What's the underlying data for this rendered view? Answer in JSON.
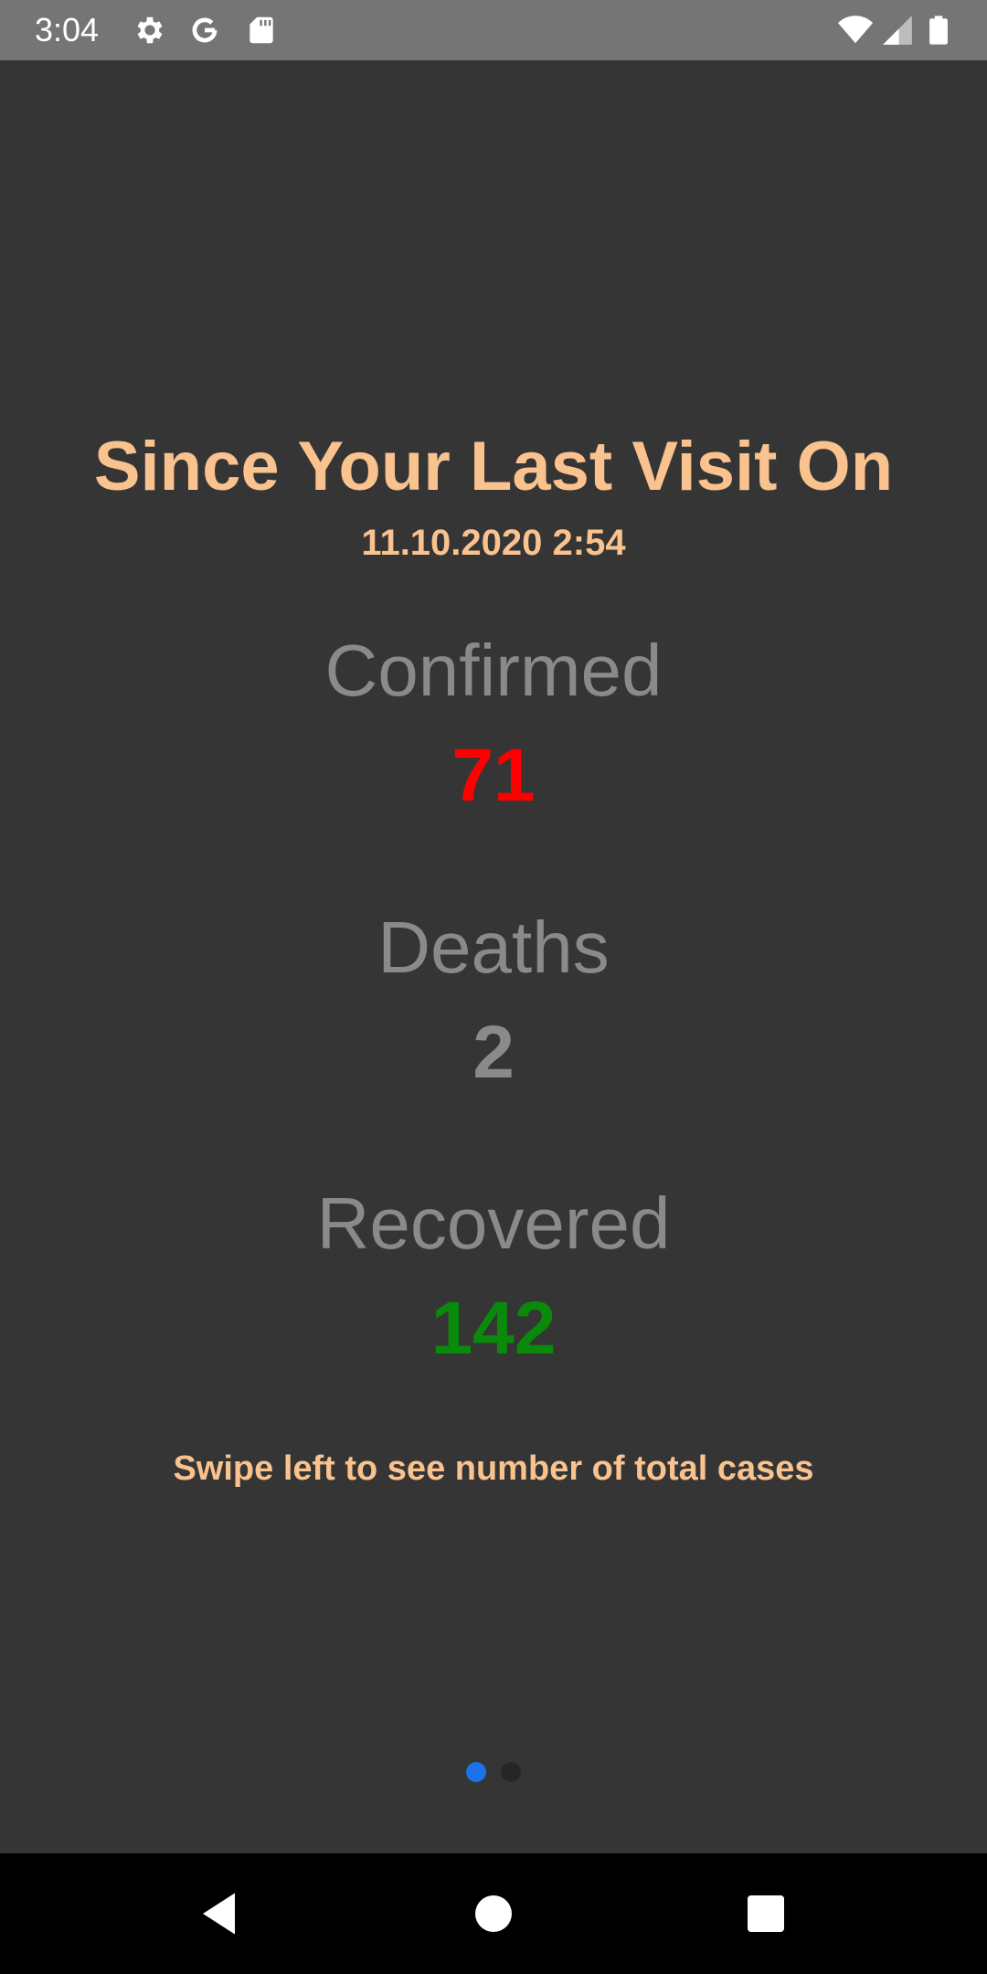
{
  "status_bar": {
    "time": "3:04",
    "icons": [
      "gear-icon",
      "google-icon",
      "sd-card-icon",
      "wifi-icon",
      "signal-icon",
      "battery-icon"
    ]
  },
  "page": {
    "title": "Since Your Last Visit On",
    "date": "11.10.2020 2:54",
    "stats": [
      {
        "label": "Confirmed",
        "value": "71",
        "color": "#ff0000"
      },
      {
        "label": "Deaths",
        "value": "2",
        "color": "#8a8a8a"
      },
      {
        "label": "Recovered",
        "value": "142",
        "color": "#0a8a0a"
      }
    ],
    "hint": "Swipe left to see number of total cases",
    "pager": {
      "count": 2,
      "active": 1
    }
  },
  "nav_bar": {
    "buttons": [
      "back-icon",
      "home-icon",
      "recents-icon"
    ]
  }
}
